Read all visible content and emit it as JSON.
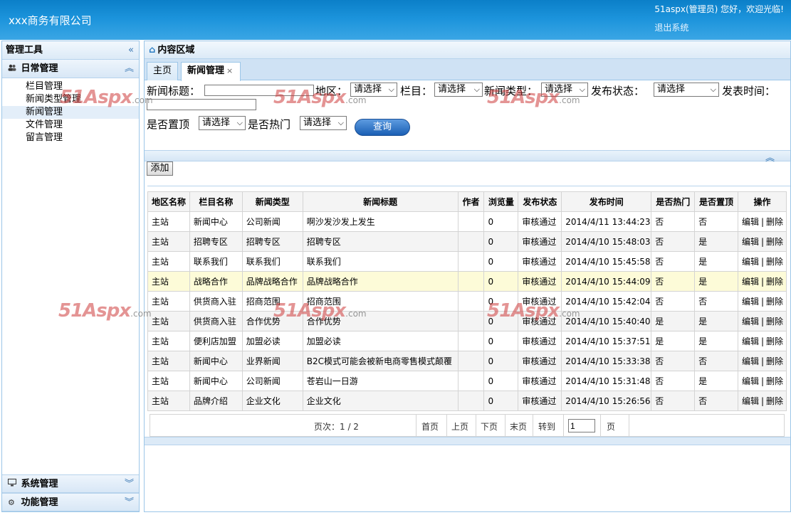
{
  "header": {
    "company": "xxx商务有限公司",
    "welcome": "51aspx(管理员) 您好，欢迎光临!",
    "logout": "退出系统"
  },
  "sidebar": {
    "title": "管理工具",
    "collapse_icon": "double-chevron-left-icon",
    "groups": [
      {
        "label": "日常管理",
        "icon": "users-icon",
        "items": [
          "栏目管理",
          "新闻类型管理",
          "新闻管理",
          "文件管理",
          "留言管理"
        ],
        "active": "新闻管理"
      },
      {
        "label": "系统管理",
        "icon": "monitor-icon"
      },
      {
        "label": "功能管理",
        "icon": "gear-icon"
      }
    ]
  },
  "content": {
    "title": "内容区域",
    "tabs": [
      {
        "label": "主页"
      },
      {
        "label": "新闻管理",
        "active": true
      }
    ]
  },
  "search": {
    "title_label": "新闻标题：",
    "region_label": "地区：",
    "column_label": "栏目：",
    "type_label": "新闻类型：",
    "status_label": "发布状态：",
    "time_label": "发表时间：",
    "top_label": "是否置顶",
    "hot_label": "是否热门",
    "select_placeholder": "请选择",
    "query_button": "查询"
  },
  "toolbar": {
    "add_button": "添加"
  },
  "table": {
    "columns": [
      "地区名称",
      "栏目名称",
      "新闻类型",
      "新闻标题",
      "作者",
      "浏览量",
      "发布状态",
      "发布时间",
      "是否热门",
      "是否置顶",
      "操作"
    ],
    "rows": [
      [
        "主站",
        "新闻中心",
        "公司新闻",
        "啊沙发沙发上发生",
        "",
        "0",
        "审核通过",
        "2014/4/11 13:44:23",
        "否",
        "否"
      ],
      [
        "主站",
        "招聘专区",
        "招聘专区",
        "招聘专区",
        "",
        "0",
        "审核通过",
        "2014/4/10 15:48:03",
        "否",
        "是"
      ],
      [
        "主站",
        "联系我们",
        "联系我们",
        "联系我们",
        "",
        "0",
        "审核通过",
        "2014/4/10 15:45:58",
        "否",
        "是"
      ],
      [
        "主站",
        "战略合作",
        "品牌战略合作",
        "品牌战略合作",
        "",
        "0",
        "审核通过",
        "2014/4/10 15:44:09",
        "否",
        "是"
      ],
      [
        "主站",
        "供货商入驻",
        "招商范围",
        "招商范围",
        "",
        "0",
        "审核通过",
        "2014/4/10 15:42:04",
        "否",
        "否"
      ],
      [
        "主站",
        "供货商入驻",
        "合作优势",
        "合作优势",
        "",
        "0",
        "审核通过",
        "2014/4/10 15:40:40",
        "是",
        "是"
      ],
      [
        "主站",
        "便利店加盟",
        "加盟必读",
        "加盟必读",
        "",
        "0",
        "审核通过",
        "2014/4/10 15:37:51",
        "是",
        "是"
      ],
      [
        "主站",
        "新闻中心",
        "业界新闻",
        "B2C模式可能会被新电商零售模式颠覆",
        "",
        "0",
        "审核通过",
        "2014/4/10 15:33:38",
        "否",
        "否"
      ],
      [
        "主站",
        "新闻中心",
        "公司新闻",
        "苍岩山一日游",
        "",
        "0",
        "审核通过",
        "2014/4/10 15:31:48",
        "否",
        "是"
      ],
      [
        "主站",
        "品牌介绍",
        "企业文化",
        "企业文化",
        "",
        "0",
        "审核通过",
        "2014/4/10 15:26:56",
        "否",
        "否"
      ]
    ],
    "edit_label": "编辑",
    "delete_label": "删除",
    "op_separator": "|"
  },
  "pager": {
    "page_info": "页次：1 / 2",
    "first": "首页",
    "prev": "上页",
    "next": "下页",
    "last": "末页",
    "goto": "转到",
    "page_value": "1",
    "page_unit": "页"
  },
  "watermark": {
    "text": "51Aspx",
    "suffix": ".com"
  },
  "colors": {
    "header": "#1b93db",
    "highlight_row": "#fdfbd8",
    "button": "#1a5fb4"
  }
}
